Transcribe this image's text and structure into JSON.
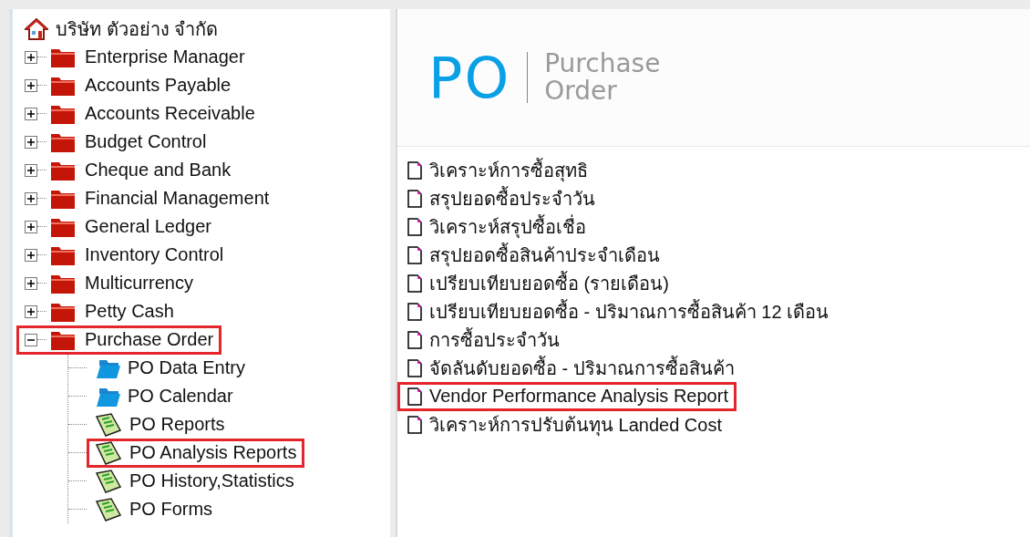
{
  "tree": {
    "root": {
      "label": "บริษัท ตัวอย่าง จำกัด"
    },
    "items": [
      {
        "label": "Enterprise Manager",
        "expanded": false,
        "highlighted": false
      },
      {
        "label": "Accounts Payable",
        "expanded": false,
        "highlighted": false
      },
      {
        "label": "Accounts Receivable",
        "expanded": false,
        "highlighted": false
      },
      {
        "label": "Budget Control",
        "expanded": false,
        "highlighted": false
      },
      {
        "label": "Cheque and Bank",
        "expanded": false,
        "highlighted": false
      },
      {
        "label": "Financial Management",
        "expanded": false,
        "highlighted": false
      },
      {
        "label": "General Ledger",
        "expanded": false,
        "highlighted": false
      },
      {
        "label": "Inventory Control",
        "expanded": false,
        "highlighted": false
      },
      {
        "label": "Multicurrency",
        "expanded": false,
        "highlighted": false
      },
      {
        "label": "Petty Cash",
        "expanded": false,
        "highlighted": false
      },
      {
        "label": "Purchase Order",
        "expanded": true,
        "highlighted": true,
        "children": [
          {
            "label": "PO Data Entry",
            "kind": "folder",
            "highlighted": false
          },
          {
            "label": "PO Calendar",
            "kind": "folder",
            "highlighted": false
          },
          {
            "label": "PO Reports",
            "kind": "report",
            "highlighted": false
          },
          {
            "label": "PO Analysis Reports",
            "kind": "report",
            "highlighted": true
          },
          {
            "label": "PO History,Statistics",
            "kind": "report",
            "highlighted": false
          },
          {
            "label": "PO Forms",
            "kind": "report",
            "highlighted": false
          }
        ]
      }
    ]
  },
  "header": {
    "code": "PO",
    "title_line_1": "Purchase",
    "title_line_2": "Order"
  },
  "reports": [
    {
      "label": "วิเคราะห์การซื้อสุทธิ",
      "highlighted": false
    },
    {
      "label": "สรุปยอดซื้อประจำวัน",
      "highlighted": false
    },
    {
      "label": "วิเคราะห์สรุปซื้อเชื่อ",
      "highlighted": false
    },
    {
      "label": "สรุปยอดซื้อสินค้าประจำเดือน",
      "highlighted": false
    },
    {
      "label": "เปรียบเทียบยอดซื้อ (รายเดือน)",
      "highlighted": false
    },
    {
      "label": "เปรียบเทียบยอดซื้อ - ปริมาณการซื้อสินค้า  12 เดือน",
      "highlighted": false
    },
    {
      "label": "การซื้อประจำวัน",
      "highlighted": false
    },
    {
      "label": "จัดลันดับยอดซื้อ - ปริมาณการซื้อสินค้า",
      "highlighted": false
    },
    {
      "label": "Vendor Performance Analysis Report",
      "highlighted": true
    },
    {
      "label": "วิเคราะห์การปรับต้นทุน Landed Cost",
      "highlighted": false
    }
  ]
}
